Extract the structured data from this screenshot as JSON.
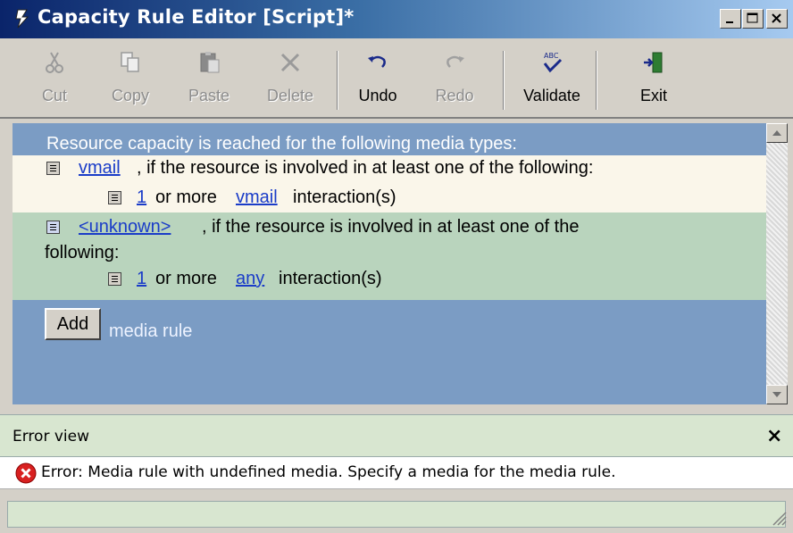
{
  "window": {
    "title": "Capacity Rule Editor [Script]*",
    "controls": [
      "minimize-icon",
      "maximize-icon",
      "close-icon"
    ]
  },
  "toolbar": {
    "cut": "Cut",
    "copy": "Copy",
    "paste": "Paste",
    "delete": "Delete",
    "undo": "Undo",
    "redo": "Redo",
    "validate": "Validate",
    "exit": "Exit",
    "disabled": [
      "Cut",
      "Copy",
      "Paste",
      "Delete",
      "Redo"
    ]
  },
  "editor": {
    "header": "Resource capacity is reached for the following media types:",
    "rules": [
      {
        "media": "vmail",
        "condition": ", if the resource is involved in at least one of the following:",
        "sub": {
          "count": "1",
          "mid": "or more",
          "media": "vmail",
          "suffix": "interaction(s)"
        }
      },
      {
        "media": "<unknown>",
        "condition": ", if the resource is involved in at least one of the",
        "condition_cont": "following:",
        "sub": {
          "count": "1",
          "mid": "or more",
          "media": "any",
          "suffix": "interaction(s)"
        }
      }
    ],
    "add_button": "Add",
    "add_suffix": "media rule"
  },
  "error_view": {
    "title": "Error view",
    "close": "×",
    "message": "Error: Media rule with undefined media. Specify a media for the media rule."
  },
  "colors": {
    "title_bar": "#0a246a",
    "editor_bg": "#7b9cc4",
    "rule_row_1": "#faf6ea",
    "rule_row_2": "#b9d4bd",
    "link": "#1a3cc8",
    "error_icon": "#d82020",
    "error_view_bg": "#d8e6d0"
  }
}
